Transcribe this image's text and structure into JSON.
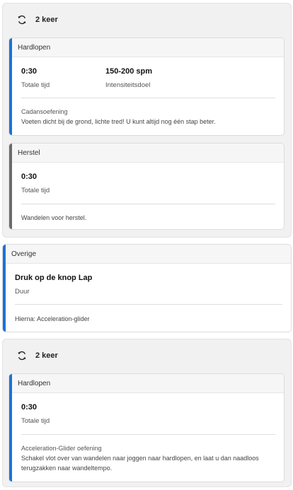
{
  "groups": [
    {
      "repeat_label": "2 keer",
      "steps": [
        {
          "type_label": "Hardlopen",
          "metric1_value": "0:30",
          "metric1_label": "Totale tijd",
          "metric2_value": "150-200 spm",
          "metric2_label": "Intensiteitsdoel",
          "note_title": "Cadansoefening",
          "note_text": "Voeten dicht bij de grond, lichte tred! U kunt altijd nog één stap beter."
        },
        {
          "type_label": "Herstel",
          "metric1_value": "0:30",
          "metric1_label": "Totale tijd",
          "note_text": "Wandelen voor herstel."
        }
      ]
    },
    {
      "repeat_label": "2 keer",
      "steps": [
        {
          "type_label": "Hardlopen",
          "metric1_value": "0:30",
          "metric1_label": "Totale tijd",
          "note_title": "Acceleration-Glider oefening",
          "note_text": "Schakel vlot over van wandelen naar joggen naar hardlopen, en laat u dan naadloos terugzakken naar wandeltempo."
        }
      ]
    }
  ],
  "other_step": {
    "type_label": "Overige",
    "title": "Druk op de knop Lap",
    "subtitle": "Duur",
    "note_text": "Hierna: Acceleration-glider"
  },
  "colors": {
    "run_accent": "#1a73d6",
    "recover_accent": "#6b6b6b"
  },
  "icons": {
    "repeat": "repeat-icon"
  }
}
